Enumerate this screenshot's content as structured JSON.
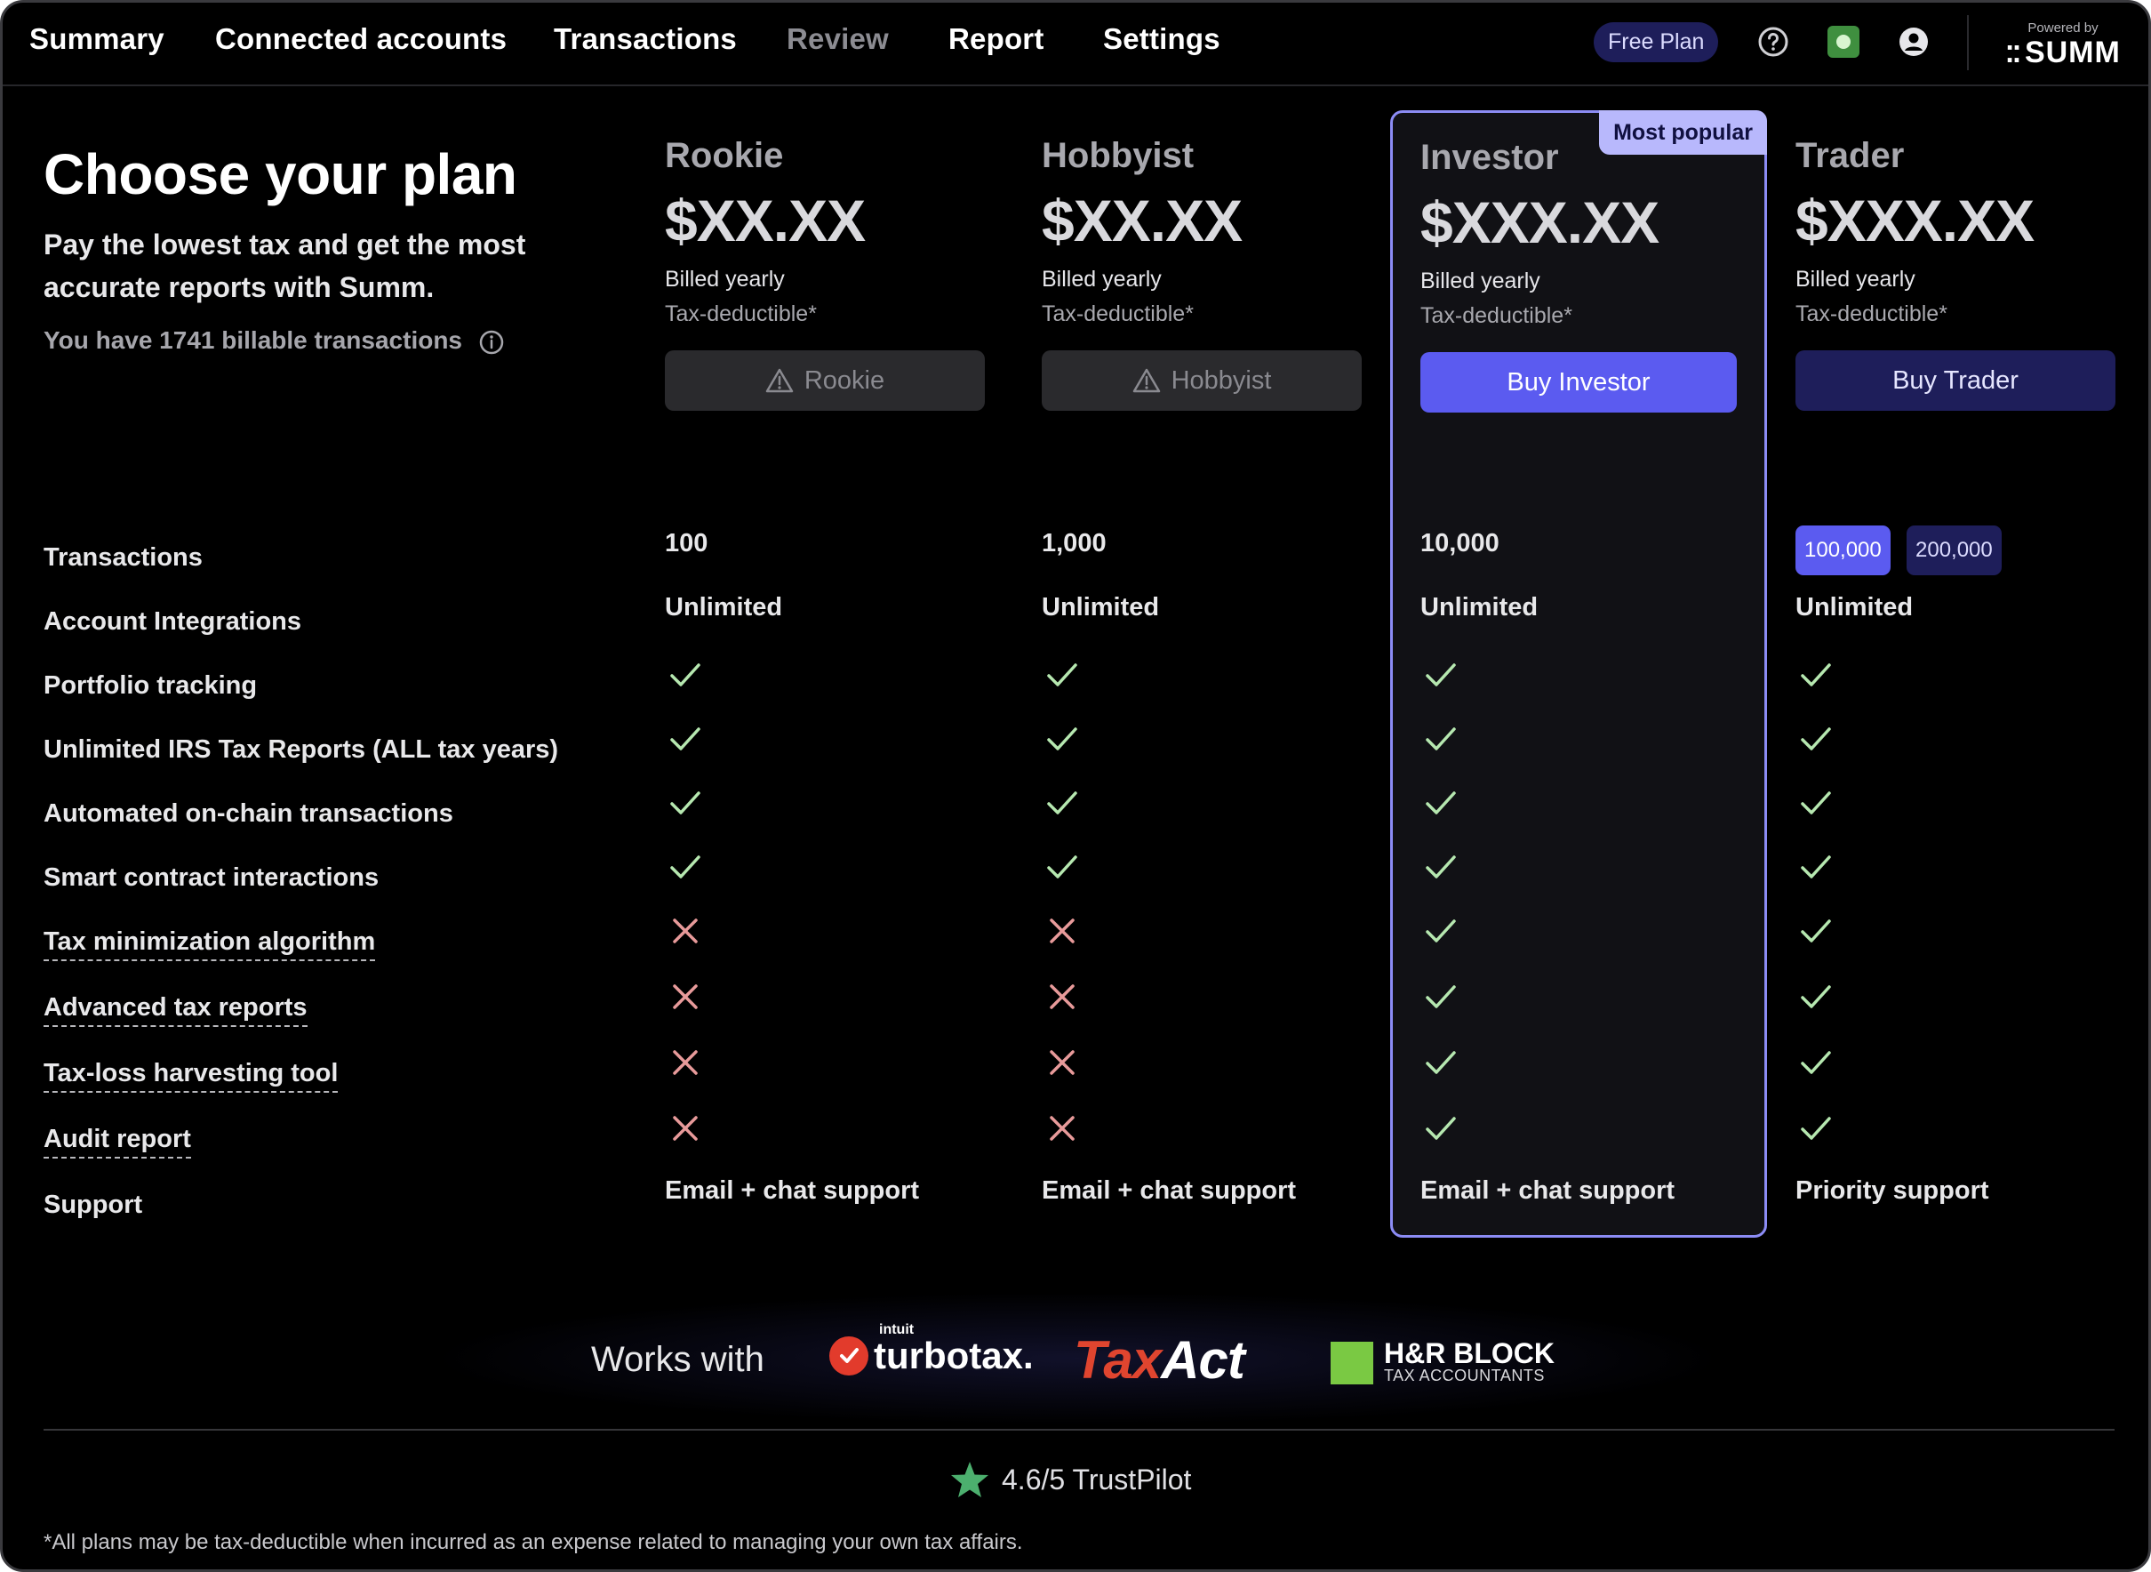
{
  "nav": {
    "items": [
      "Summary",
      "Connected accounts",
      "Transactions",
      "Review",
      "Report",
      "Settings"
    ],
    "free_plan": "Free Plan",
    "powered_by": "Powered by",
    "brand": "SUMM"
  },
  "intro": {
    "title": "Choose your plan",
    "subtitle": "Pay the lowest tax and get the most accurate reports with Summ.",
    "billable": "You have 1741 billable transactions"
  },
  "plans": [
    {
      "name": "Rookie",
      "price": "$XX.XX",
      "billed": "Billed yearly",
      "tax": "Tax-deductible*",
      "button": "Rookie",
      "transactions": "100",
      "integrations": "Unlimited",
      "support": "Email + chat support"
    },
    {
      "name": "Hobbyist",
      "price": "$XX.XX",
      "billed": "Billed yearly",
      "tax": "Tax-deductible*",
      "button": "Hobbyist",
      "transactions": "1,000",
      "integrations": "Unlimited",
      "support": "Email + chat support"
    },
    {
      "name": "Investor",
      "price": "$XXX.XX",
      "billed": "Billed yearly",
      "tax": "Tax-deductible*",
      "button": "Buy Investor",
      "transactions": "10,000",
      "integrations": "Unlimited",
      "support": "Email + chat support",
      "badge": "Most popular"
    },
    {
      "name": "Trader",
      "price": "$XXX.XX",
      "billed": "Billed yearly",
      "tax": "Tax-deductible*",
      "button": "Buy Trader",
      "transaction_options": [
        "100,000",
        "200,000"
      ],
      "integrations": "Unlimited",
      "support": "Priority support"
    }
  ],
  "features": [
    {
      "label": "Transactions"
    },
    {
      "label": "Account Integrations"
    },
    {
      "label": "Portfolio tracking",
      "included": [
        true,
        true,
        true,
        true
      ]
    },
    {
      "label": "Unlimited IRS Tax Reports (ALL tax years)",
      "included": [
        true,
        true,
        true,
        true
      ]
    },
    {
      "label": "Automated on-chain transactions",
      "included": [
        true,
        true,
        true,
        true
      ]
    },
    {
      "label": "Smart contract interactions",
      "included": [
        true,
        true,
        true,
        true
      ]
    },
    {
      "label": "Tax minimization algorithm",
      "included": [
        false,
        false,
        true,
        true
      ]
    },
    {
      "label": "Advanced tax reports",
      "included": [
        false,
        false,
        true,
        true
      ]
    },
    {
      "label": "Tax-loss harvesting tool",
      "included": [
        false,
        false,
        true,
        true
      ]
    },
    {
      "label": "Audit report",
      "included": [
        false,
        false,
        true,
        true
      ]
    },
    {
      "label": "Support"
    }
  ],
  "works_with": {
    "label": "Works with",
    "turbotax_small": "intuit",
    "turbotax": "turbotax.",
    "taxact_a": "Tax",
    "taxact_b": "Act",
    "hrblock": "H&R BLOCK",
    "hrblock_sub": "TAX ACCOUNTANTS"
  },
  "trustpilot": "4.6/5 TrustPilot",
  "footnote": "*All plans may be tax-deductible when incurred as an expense related to managing your own tax affairs.",
  "colors": {
    "accent": "#5b5bf0",
    "dark_accent": "#1e1e5a",
    "check": "#b6e8b0",
    "cross": "#e89a9a",
    "star": "#4caf6e"
  }
}
